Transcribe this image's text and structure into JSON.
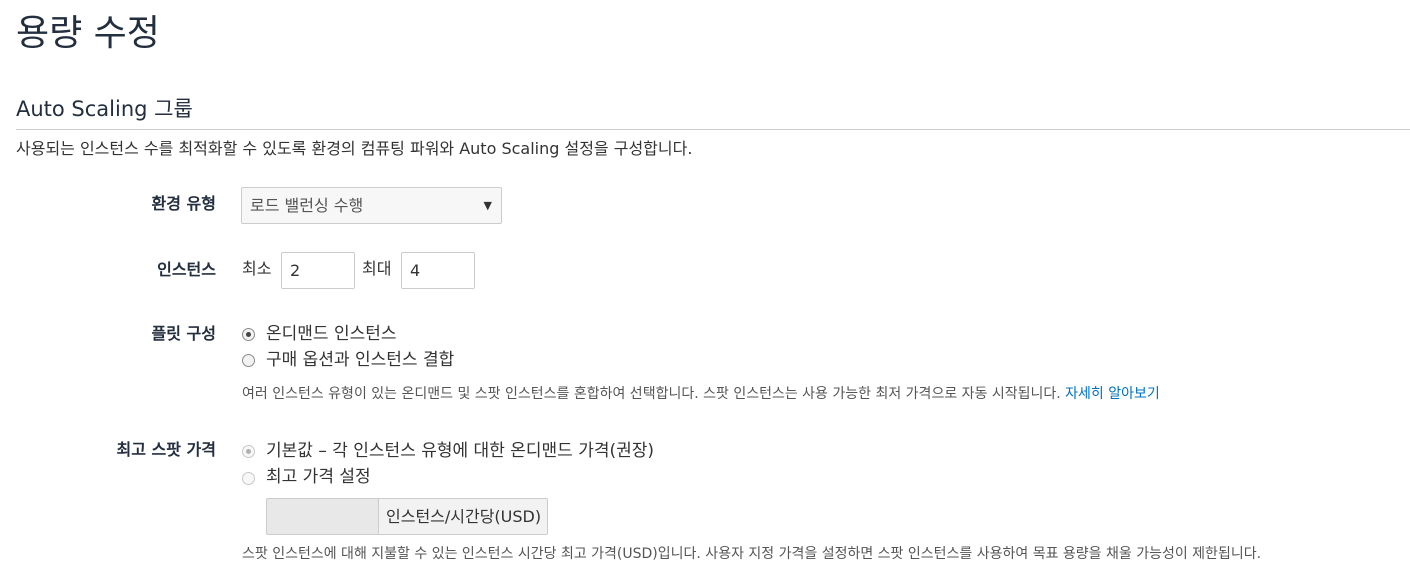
{
  "page": {
    "title": "용량 수정"
  },
  "section": {
    "title": "Auto Scaling 그룹",
    "description": "사용되는 인스턴스 수를 최적화할 수 있도록 환경의 컴퓨팅 파워와 Auto Scaling 설정을 구성합니다."
  },
  "environment_type": {
    "label": "환경 유형",
    "selected": "로드 밸런싱 수행",
    "arrow_icon": "caret-down-icon"
  },
  "instances": {
    "label": "인스턴스",
    "min_label": "최소",
    "min_value": "2",
    "max_label": "최대",
    "max_value": "4"
  },
  "fleet": {
    "label": "플릿 구성",
    "options": [
      {
        "label": "온디맨드 인스턴스",
        "checked": true
      },
      {
        "label": "구매 옵션과 인스턴스 결합",
        "checked": false
      }
    ],
    "help": "여러 인스턴스 유형이 있는 온디맨드 및 스팟 인스턴스를 혼합하여 선택합니다. 스팟 인스턴스는 사용 가능한 최저 가격으로 자동 시작됩니다.",
    "learn_more": "자세히 알아보기"
  },
  "spot_price": {
    "label": "최고 스팟 가격",
    "options": [
      {
        "label": "기본값 – 각 인스턴스 유형에 대한 온디맨드 가격(권장)",
        "checked": true
      },
      {
        "label": "최고 가격 설정",
        "checked": false
      }
    ],
    "price_value": "",
    "unit": "인스턴스/시간당(USD)",
    "help": "스팟 인스턴스에 대해 지불할 수 있는 인스턴스 시간당 최고 가격(USD)입니다. 사용자 지정 가격을 설정하면 스팟 인스턴스를 사용하여 목표 용량을 채울 가능성이 제한됩니다."
  }
}
